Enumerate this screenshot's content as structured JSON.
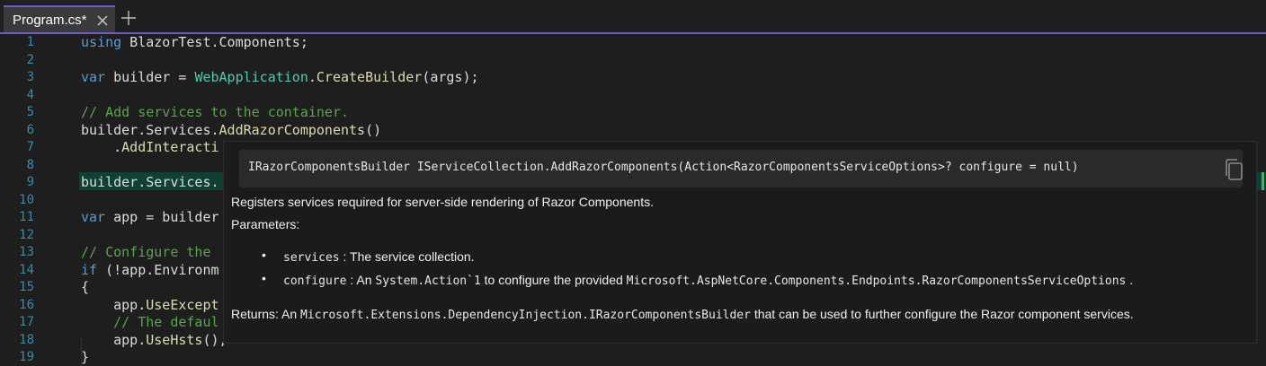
{
  "tab": {
    "label": "Program.cs*"
  },
  "line_numbers": [
    "1",
    "2",
    "3",
    "4",
    "5",
    "6",
    "7",
    "8",
    "9",
    "10",
    "11",
    "12",
    "13",
    "14",
    "15",
    "16",
    "17",
    "18",
    "19"
  ],
  "code": {
    "l1_kw": "using",
    "l1_rest": " BlazorTest.Components;",
    "l3_kw": "var",
    "l3_a": " builder = ",
    "l3_type": "WebApplication",
    "l3_b": ".",
    "l3_method": "CreateBuilder",
    "l3_c": "(args);",
    "l5_comment": "// Add services to the container.",
    "l6_a": "builder.Services.",
    "l6_method": "AddRazorComponents",
    "l6_b": "()",
    "l7_a": "    .",
    "l7_method": "AddInteracti",
    "l9_a": "builder.Services.",
    "l11_kw": "var",
    "l11_rest": " app = builder",
    "l13_comment": "// Configure the ",
    "l14_kw": "if",
    "l14_rest": " (!app.Environm",
    "l15": "{",
    "l16_a": "    app.",
    "l16_method": "UseExcept",
    "l17_comment": "    // The defaul",
    "l18_a": "    app.",
    "l18_method": "UseHsts",
    "l18_b": "(),",
    "l19": "}"
  },
  "tooltip": {
    "signature": "IRazorComponentsBuilder IServiceCollection.AddRazorComponents(Action<RazorComponentsServiceOptions>? configure = null)",
    "summary": "Registers services required for server-side rendering of Razor Components.",
    "params_heading": "Parameters:",
    "param1_name": "services",
    "param1_desc": " : The service collection.",
    "param2_name": "configure",
    "param2_a": " : An ",
    "param2_type": "System.Action`1",
    "param2_b": " to configure the provided ",
    "param2_type2": "Microsoft.AspNetCore.Components.Endpoints.RazorComponentsServiceOptions",
    "param2_c": " .",
    "returns_a": "Returns: An ",
    "returns_type": "Microsoft.Extensions.DependencyInjection.IRazorComponentsBuilder",
    "returns_b": " that can be used to further configure the Razor component services."
  },
  "colors": {
    "accent": "#6b5cc8",
    "keyword": "#569cd6",
    "type": "#4ec9b0",
    "method": "#dcdcaa",
    "comment": "#57a64a",
    "line_number": "#2b91af"
  },
  "icons": {
    "tab_close": "close-icon",
    "new_tab": "plus-icon",
    "copy": "copy-icon"
  }
}
